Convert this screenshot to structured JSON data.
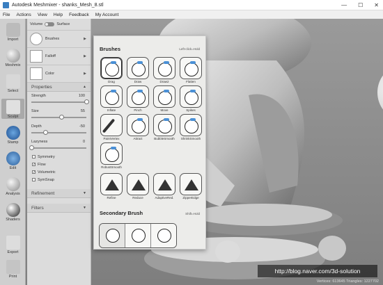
{
  "window": {
    "title": "Autodesk Meshmixer - shanks_Mesh_8.stl",
    "min": "—",
    "max": "☐",
    "close": "✕"
  },
  "menu": [
    "File",
    "Actions",
    "View",
    "Help",
    "Feedback",
    "My Account"
  ],
  "toolbar": [
    {
      "label": "Import",
      "icon": "plus-icon"
    },
    {
      "label": "Meshmix",
      "icon": "meshmix-icon"
    },
    {
      "label": "Select",
      "icon": "select-arrow-icon"
    },
    {
      "label": "Sculpt",
      "icon": "sculpt-brush-icon",
      "active": true
    },
    {
      "label": "Stamp",
      "icon": "stamp-icon"
    },
    {
      "label": "Edit",
      "icon": "edit-icon"
    },
    {
      "label": "Analysis",
      "icon": "analysis-icon"
    },
    {
      "label": "Shaders",
      "icon": "shaders-icon"
    },
    {
      "label": "Export",
      "icon": "export-icon"
    },
    {
      "label": "Print",
      "icon": "print-icon"
    }
  ],
  "panel": {
    "volume": "Volume",
    "surface": "Surface",
    "brushes": "Brushes",
    "falloff": "Falloff",
    "color": "Color",
    "properties": "Properties",
    "strength": {
      "label": "Strength",
      "value": "100",
      "fraction": 1.0
    },
    "size": {
      "label": "Size",
      "value": "55",
      "fraction": 0.55
    },
    "depth": {
      "label": "Depth",
      "value": "-50",
      "fraction": 0.25
    },
    "lazyness": {
      "label": "Lazyness",
      "value": "0",
      "fraction": 0.0
    },
    "checks": [
      {
        "label": "Symmetry",
        "checked": false
      },
      {
        "label": "Flow",
        "checked": true
      },
      {
        "label": "Volumetric",
        "checked": true
      },
      {
        "label": "SymSnap",
        "checked": false
      }
    ],
    "refinement": "Refinement",
    "filters": "Filters"
  },
  "popup": {
    "title": "Brushes",
    "limit": "Left-click=Hold",
    "brushes": [
      {
        "label": "Drag",
        "sel": true
      },
      {
        "label": "Draw"
      },
      {
        "label": "Draw2"
      },
      {
        "label": "Flatten"
      },
      {
        "label": "Inflate"
      },
      {
        "label": "Pinch"
      },
      {
        "label": "Move"
      },
      {
        "label": "Spikes"
      },
      {
        "label": "PaintVertex",
        "kind": "pen"
      },
      {
        "label": "Attract"
      },
      {
        "label": "BubbleSmooth"
      },
      {
        "label": "ShrinkSmooth"
      },
      {
        "label": "RobustSmooth"
      },
      {
        "label": "Refine",
        "kind": "tri"
      },
      {
        "label": "Reduce",
        "kind": "tri"
      },
      {
        "label": "AdaptiveRed.",
        "kind": "tri"
      },
      {
        "label": "ZipperEdge",
        "kind": "tri"
      }
    ],
    "secondary_title": "Secondary Brush",
    "secondary_hint": "Shift=Hold"
  },
  "status": "Vertices: 613645  Triangles: 1227702",
  "watermark": "http://blog.naver.com/3d-solution"
}
